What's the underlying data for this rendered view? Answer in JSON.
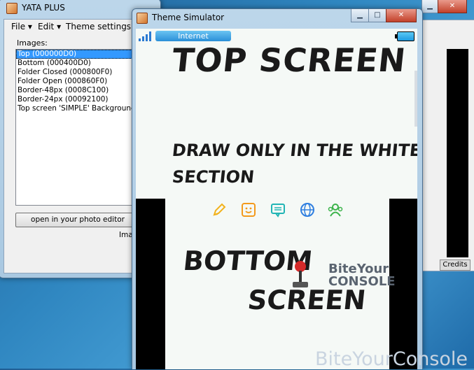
{
  "yata": {
    "title": "YATA PLUS",
    "menu": {
      "file": "File",
      "edit": "Edit",
      "theme_settings": "Theme settings"
    },
    "images_label": "Images:",
    "images": [
      "Top (000000D0)",
      "Bottom (000400D0)",
      "Folder Closed (000800F0)",
      "Folder Open (000860F0)",
      "Border-48px (0008C100)",
      "Border-24px (00092100)",
      "Top screen 'SIMPLE' Background"
    ],
    "selected_index": 0,
    "open_button": "open in your photo editor",
    "partial_label": "Ima",
    "credits": "Credits"
  },
  "simulator": {
    "title": "Theme Simulator",
    "internet": "Internet",
    "top_text": "TOP SCREEN",
    "draw_line1": "DRAW ONLY IN THE WHITE",
    "draw_line2": "SECTION",
    "bottom_text": "BOTTOM",
    "screen_text": "SCREEN",
    "watermark_line1": "BiteYour",
    "watermark_line2": "CONSOLE"
  },
  "desktop_watermark": "BiteYourConsole",
  "icons": {
    "pencil": "pencil-icon",
    "smiley": "smiley-icon",
    "chat": "chat-icon",
    "globe": "globe-icon",
    "friends": "friends-icon"
  },
  "colors": {
    "selection": "#3399ff",
    "internet_bar": "#2a8fd8",
    "pencil": "#f2b21c",
    "smiley": "#f39a1c",
    "chat": "#21b5b5",
    "globe": "#2f7fe0",
    "friends": "#3bb34a"
  }
}
